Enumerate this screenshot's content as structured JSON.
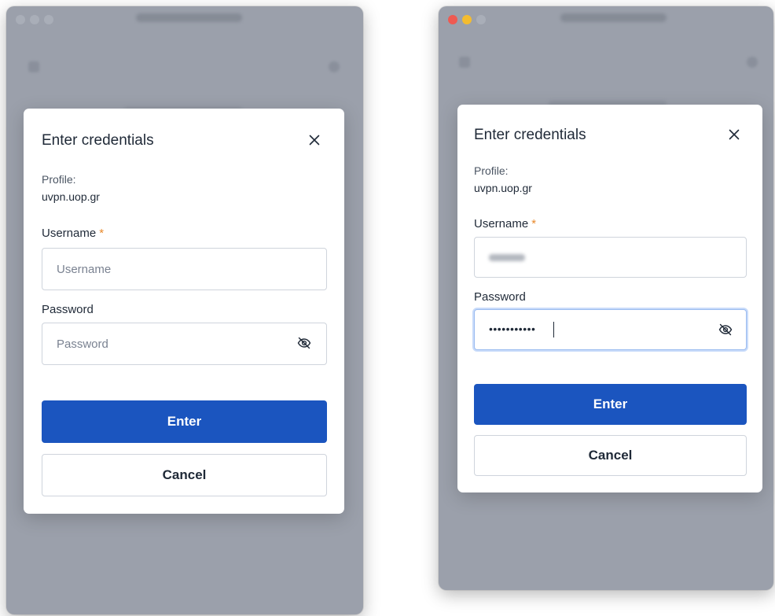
{
  "colors": {
    "primary": "#1b55bf",
    "required": "#e8892b",
    "traffic_close": "#ee5a52",
    "traffic_minimize": "#f4bc2f",
    "traffic_inactive": "#a9aeb8"
  },
  "left": {
    "dialog": {
      "title": "Enter credentials",
      "close_icon": "close-icon",
      "profile_label": "Profile:",
      "profile_value": "uvpn.uop.gr",
      "username_label": "Username",
      "required_mark": "*",
      "username_placeholder": "Username",
      "username_value": "",
      "password_label": "Password",
      "password_placeholder": "Password",
      "password_value": "",
      "eye_icon": "eye-off-icon",
      "enter_label": "Enter",
      "cancel_label": "Cancel"
    }
  },
  "right": {
    "dialog": {
      "title": "Enter credentials",
      "close_icon": "close-icon",
      "profile_label": "Profile:",
      "profile_value": "uvpn.uop.gr",
      "username_label": "Username",
      "required_mark": "*",
      "password_label": "Password",
      "password_masked": "•••••••••••",
      "eye_icon": "eye-off-icon",
      "enter_label": "Enter",
      "cancel_label": "Cancel"
    }
  }
}
